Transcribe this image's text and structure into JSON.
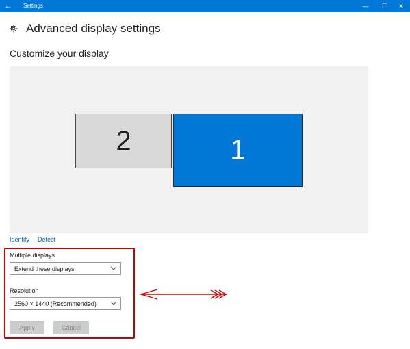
{
  "window": {
    "title": "Settings",
    "back_glyph": "←",
    "min_glyph": "—",
    "max_glyph": "☐",
    "close_glyph": "✕"
  },
  "page": {
    "title": "Advanced display settings",
    "icon": "gear-icon"
  },
  "customize": {
    "title": "Customize your display",
    "monitors": [
      {
        "label": "2",
        "selected": false
      },
      {
        "label": "1",
        "selected": true
      }
    ]
  },
  "links": {
    "identify": "Identify",
    "detect": "Detect"
  },
  "multiple_displays": {
    "label": "Multiple displays",
    "value": "Extend these displays"
  },
  "resolution": {
    "label": "Resolution",
    "value": "2560 × 1440 (Recommended)"
  },
  "buttons": {
    "apply": "Apply",
    "cancel": "Cancel"
  },
  "colors": {
    "accent": "#0078d7",
    "annotation": "#cc0000"
  }
}
